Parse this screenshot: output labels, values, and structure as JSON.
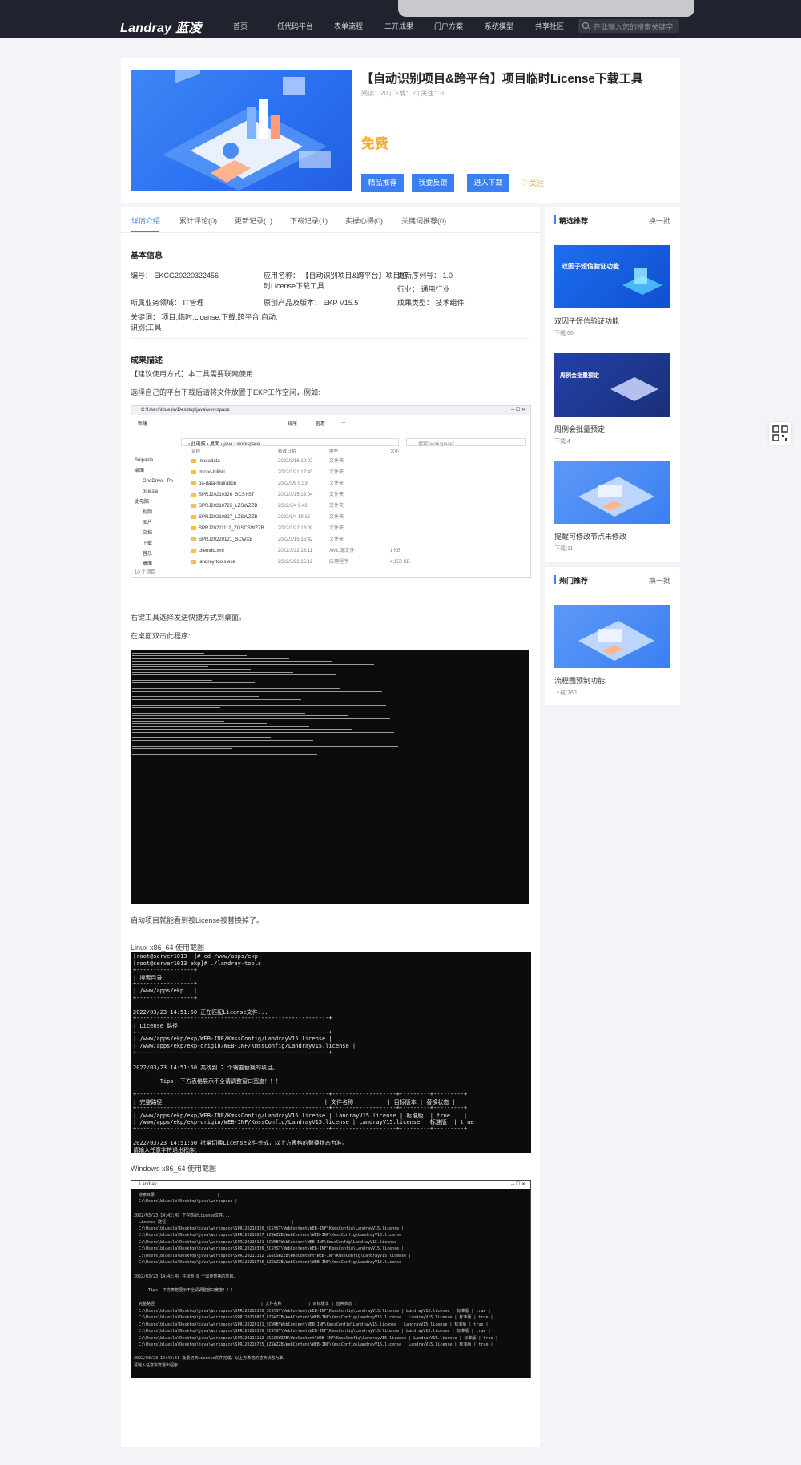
{
  "header": {
    "logo": "Landray 蓝凌",
    "nav": [
      "首页",
      "低代码平台",
      "表单流程",
      "二开成果",
      "门户方案",
      "系统模型",
      "共享社区"
    ],
    "search_placeholder": "在此输入您的搜索关键字"
  },
  "product": {
    "title": "【自动识别项目&跨平台】项目临时License下载工具",
    "stats": "阅读：20 | 下载：2 | 关注：0",
    "price": "免费",
    "buttons": [
      "精品推荐",
      "我要反馈",
      "进入下载"
    ],
    "follow": "关注"
  },
  "tabs": [
    "详情介绍",
    "累计评论(0)",
    "更新记录(1)",
    "下载记录(1)",
    "实操心得(0)",
    "关键词推荐(0)"
  ],
  "basic": {
    "heading": "基本信息",
    "code": "编号：  EKCG20220322456",
    "app_name_1": "应用名称：  【自动识别项目&跨平台】项目临",
    "app_name_2": "时License下载工具",
    "version": "更新序列号：  1.0",
    "industry": "行业：  通用行业",
    "domain": "所属业务领域：  IT管理",
    "product": "原创产品及版本：  EKP V15.5",
    "type": "成果类型：  技术组件",
    "keywords_1": "关键词：  项目;临时;License;下载;跨平台;自动;",
    "keywords_2": "识别;工具"
  },
  "desc": {
    "heading": "成果描述",
    "p1": "【建议使用方式】本工具需要联网使用",
    "p2": "选择自己的平台下载后请将文件放置于EKP工作空间，例如:",
    "p3": "右键工具选择发送快捷方式到桌面。",
    "p4": "在桌面双击此程序:",
    "p5": "启动项目就能看到被License被替换掉了。",
    "p6": "Linux x86_64 使用截图",
    "p7": "Windows x86_64 使用截图"
  },
  "explorer": {
    "path": "C:\\Users\\bluesla\\Desktop\\java\\workspace",
    "toolbar": [
      "新建",
      "排序",
      "查看",
      "..."
    ],
    "breadcrumb": "› 此电脑 › 桌面 › java › workspace",
    "search": "搜索\"workspace\"",
    "headers": [
      "名称",
      "修改日期",
      "类型",
      "大小"
    ],
    "tree": [
      "Snipaste",
      "桌面",
      "OneDrive - Pe",
      "bluesla",
      "此电脑",
      "视频",
      "图片",
      "文档",
      "下载",
      "音乐",
      "桌面"
    ],
    "files": [
      {
        "name": ".metadata",
        "date": "2022/3/16 10:02",
        "type": "文件夹",
        "size": ""
      },
      {
        "name": "imooc-bilibili",
        "date": "2022/3/21 17:43",
        "type": "文件夹",
        "size": ""
      },
      {
        "name": "oa-data-migration",
        "date": "2022/3/8 9:33",
        "type": "文件夹",
        "size": ""
      },
      {
        "name": "SPRJ20210326_SCSYST",
        "date": "2022/3/15 19:04",
        "type": "文件夹",
        "size": ""
      },
      {
        "name": "SPRJ20210725_LZSWZZB",
        "date": "2022/3/4 9:42",
        "type": "文件夹",
        "size": ""
      },
      {
        "name": "SPRJ20210827_LZSWZZB",
        "date": "2022/3/4 19:15",
        "type": "文件夹",
        "size": ""
      },
      {
        "name": "SPRJ20211112_ZGSCSWZZB",
        "date": "2022/3/22 13:09",
        "type": "文件夹",
        "size": ""
      },
      {
        "name": "SPRJ20220121_SCWXB",
        "date": "2022/3/15 16:42",
        "type": "文件夹",
        "size": ""
      },
      {
        "name": "clientdb.xml",
        "date": "2022/3/22 13:11",
        "type": "XML 源文件",
        "size": "1 KB"
      },
      {
        "name": "landray-tools.exe",
        "date": "2022/3/22 15:12",
        "type": "应用程序",
        "size": "4,150 KB"
      }
    ],
    "status": "10 个项目"
  },
  "linux": [
    "[root@server1013 ~]# cd /www/apps/ekp",
    "[root@server1013 ekp]# ./landray-tools",
    "+-----------------+",
    "| 搜索目录        |",
    "+-----------------+",
    "| /www/apps/ekp   |",
    "+-----------------+",
    "",
    "2022/03/23 14:51:50 正在匹配License文件...",
    "+---------------------------------------------------------+",
    "| License 路径                                            |",
    "+---------------------------------------------------------+",
    "| /www/apps/ekp/ekp/WEB-INF/KmssConfig/LandrayV15.license |",
    "| /www/apps/ekp/ekp-origin/WEB-INF/KmssConfig/LandrayV15.license |",
    "+---------------------------------------------------------+",
    "",
    "2022/03/23 14:51:50 共找到 2 个需要替换的项目。",
    "",
    "        Tips: 下方表格展示不全请调整窗口宽度！！！",
    "",
    "+---------------------------------------------------------+-------------------+---------+---------+",
    "| 完整路径                                                | 文件名称          | 目标版本 | 替换状态 |",
    "+---------------------------------------------------------+-------------------+---------+---------+",
    "| /www/apps/ekp/ekp/WEB-INF/KmssConfig/LandrayV15.license | LandrayV15.license | 标准版  | true    |",
    "| /www/apps/ekp/ekp-origin/WEB-INF/KmssConfig/LandrayV15.license | LandrayV15.license | 标准版  | true    |",
    "+---------------------------------------------------------+-------------------+---------+---------+",
    "",
    "2022/03/23 14:51:50 批量切换License文件完成，以上方表格的替换状态为准。",
    "请输入任意字符退出程序："
  ],
  "windows": {
    "title": "Landray",
    "lines": [
      "| 搜索目录                          |",
      "| C:\\Users\\bluesla\\Desktop\\java\\workspace |",
      "",
      "2022/03/23 14:42:49 正在匹配License文件...",
      "| License 路径                                                    |",
      "| C:\\Users\\bluesla\\Desktop\\java\\workspace\\SPRJ20210326_SCSYST\\WebContent\\WEB-INF\\KmssConfig\\LandrayV15.license |",
      "| C:\\Users\\bluesla\\Desktop\\java\\workspace\\SPRJ20210827_LZSWZZB\\WebContent\\WEB-INF\\KmssConfig\\LandrayV15.license |",
      "| C:\\Users\\bluesla\\Desktop\\java\\workspace\\SPRJ20220121_SCWXB\\WebContent\\WEB-INF\\KmssConfig\\LandrayV15.license |",
      "| C:\\Users\\bluesla\\Desktop\\java\\workspace\\SPRJ20210326_SCSYST\\WebContent\\WEB-INF\\KmssConfig\\LandrayV15.license |",
      "| C:\\Users\\bluesla\\Desktop\\java\\workspace\\SPRJ20211112_ZGSCSWZZB\\WebContent\\WEB-INF\\KmssConfig\\LandrayV15.license |",
      "| C:\\Users\\bluesla\\Desktop\\java\\workspace\\SPRJ20210725_LZSWZZB\\WebContent\\WEB-INF\\KmssConfig\\LandrayV15.license |",
      "",
      "2022/03/23 14:42:49 共找到 6 个需要替换的项目。",
      "",
      "      Tips: 下方表格展示不全请调整窗口宽度！！！",
      "",
      "| 完整路径                                            | 文件名称           | 目标版本 | 替换状态 |",
      "| C:\\Users\\bluesla\\Desktop\\java\\workspace\\SPRJ20210326_SCSYST\\WebContent\\WEB-INF\\KmssConfig\\LandrayV15.license | LandrayV15.license | 标准版 | true |",
      "| C:\\Users\\bluesla\\Desktop\\java\\workspace\\SPRJ20210827_LZSWZZB\\WebContent\\WEB-INF\\KmssConfig\\LandrayV15.license | LandrayV15.license | 标准版 | true |",
      "| C:\\Users\\bluesla\\Desktop\\java\\workspace\\SPRJ20220121_SCWXB\\WebContent\\WEB-INF\\KmssConfig\\LandrayV15.license | LandrayV15.license | 标准版 | true |",
      "| C:\\Users\\bluesla\\Desktop\\java\\workspace\\SPRJ20210326_SCSYST\\WebContent\\WEB-INF\\KmssConfig\\LandrayV15.license | LandrayV15.license | 标准版 | true |",
      "| C:\\Users\\bluesla\\Desktop\\java\\workspace\\SPRJ20211112_ZGSCSWZZB\\WebContent\\WEB-INF\\KmssConfig\\LandrayV15.license | LandrayV15.license | 标准版 | true |",
      "| C:\\Users\\bluesla\\Desktop\\java\\workspace\\SPRJ20210725_LZSWZZB\\WebContent\\WEB-INF\\KmssConfig\\LandrayV15.license | LandrayV15.license | 标准版 | true |",
      "",
      "2022/03/23 14:42:51 批量切换License文件完成，以上方表格的替换状态为准。",
      "请输入任意字符退出程序："
    ]
  },
  "sidebar": {
    "picks": {
      "title": "精选推荐",
      "more": "换一批",
      "items": [
        {
          "img_text": "双因子短信验证功能",
          "name": "双因子短信验证功能",
          "downloads": "下载:66"
        },
        {
          "img_text": "周例会批量预定",
          "name": "周例会批量预定",
          "downloads": "下载:4"
        },
        {
          "img_text": "",
          "name": "提醒可修改节点未修改",
          "downloads": "下载:11"
        }
      ]
    },
    "hot": {
      "title": "热门推荐",
      "more": "换一批",
      "items": [
        {
          "name": "流程图预制功能",
          "downloads": "下载:260"
        }
      ]
    }
  },
  "colors": {
    "accent": "#3a80f2",
    "price": "#f4ab2c",
    "topbar": "#20232d"
  }
}
